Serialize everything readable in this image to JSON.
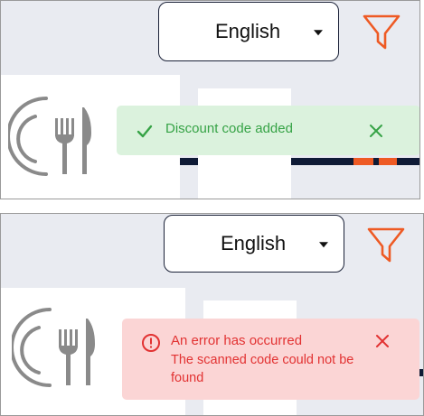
{
  "screens": [
    {
      "language_select": {
        "value": "English",
        "icon": "chevron-down-icon"
      },
      "filter_button": {
        "icon": "filter-icon",
        "color": "#ee5a24"
      },
      "product_card": {
        "icon": "plate-cutlery-icon"
      },
      "toast": {
        "type": "success",
        "message": "Discount code added",
        "icon": "check-icon",
        "close_icon": "close-icon",
        "background": "#dbf2dd",
        "color": "#36a346"
      }
    },
    {
      "language_select": {
        "value": "English",
        "icon": "chevron-down-icon"
      },
      "filter_button": {
        "icon": "filter-icon",
        "color": "#ee5a24"
      },
      "product_card": {
        "icon": "plate-cutlery-icon"
      },
      "toast": {
        "type": "error",
        "title": "An error has occurred",
        "message": "The scanned code could not be found",
        "icon": "alert-circle-icon",
        "close_icon": "close-icon",
        "background": "#fbd5d5",
        "color": "#e23232"
      }
    }
  ],
  "colors": {
    "background": "#e9ebf1",
    "navy": "#0f1b36",
    "accent": "#ee5a24",
    "icon_gray": "#8a8a8a"
  }
}
